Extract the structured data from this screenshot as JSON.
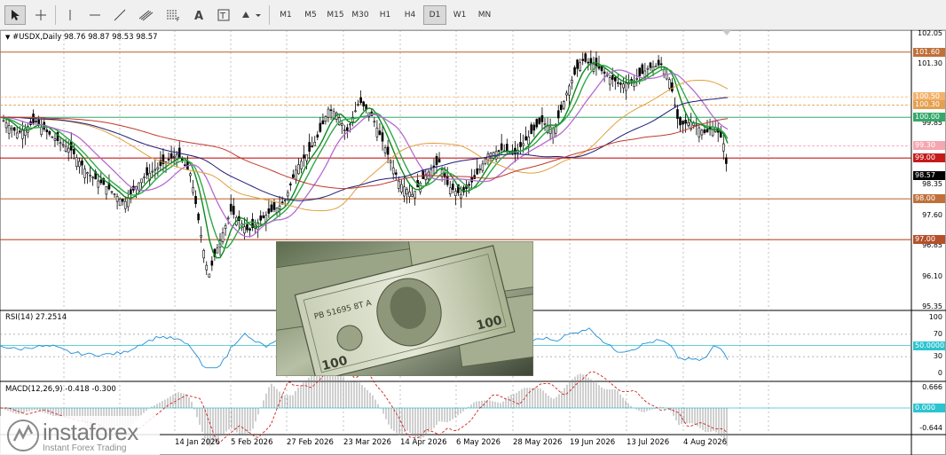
{
  "toolbar": {
    "timeframes": [
      "M1",
      "M5",
      "M15",
      "M30",
      "H1",
      "H4",
      "D1",
      "W1",
      "MN"
    ],
    "active_timeframe": "D1"
  },
  "chart": {
    "header": "#USDX,Daily  98.76 98.87 98.53 98.57",
    "current_price": "98.57",
    "price_scale": [
      "102.05",
      "101.30",
      "99.85",
      "98.35",
      "97.60",
      "96.85",
      "96.10",
      "95.35"
    ],
    "hline_labels": [
      {
        "text": "101.60",
        "color": "#c0703a"
      },
      {
        "text": "100.50",
        "color": "#f2b26b"
      },
      {
        "text": "100.30",
        "color": "#e3a04f"
      },
      {
        "text": "100.00",
        "color": "#35a86b"
      },
      {
        "text": "99.30",
        "color": "#f4a6b1"
      },
      {
        "text": "99.00",
        "color": "#c51a1a"
      },
      {
        "text": "98.00",
        "color": "#c0703a"
      },
      {
        "text": "97.00",
        "color": "#b5502a"
      }
    ],
    "dates": [
      "14 Jan 2026",
      "5 Feb 2026",
      "27 Feb 2026",
      "23 Mar 2026",
      "14 Apr 2026",
      "6 May 2026",
      "28 May 2026",
      "19 Jun 2026",
      "13 Jul 2026",
      "4 Aug 2026"
    ]
  },
  "rsi": {
    "header": "RSI(14) 27.2514",
    "scale": [
      "100",
      "70",
      "30",
      "0"
    ],
    "level_label": "50.0000"
  },
  "macd": {
    "header": "MACD(12,26,9) -0.418 -0.300",
    "scale": [
      "0.666",
      "-0.644"
    ],
    "zero_label": "0.000"
  },
  "watermark": {
    "brand": "instaforex",
    "tagline": "Instant Forex Trading"
  },
  "colors": {
    "ma_green_dark": "#0a8a1a",
    "ma_green": "#2fa84a",
    "ma_violet": "#b56ad0",
    "ma_navy": "#1c1c7a",
    "ma_red": "#c0392b",
    "ma_orange": "#e0a040",
    "rsi_line": "#1e8fd6",
    "macd_signal": "#d02020"
  }
}
